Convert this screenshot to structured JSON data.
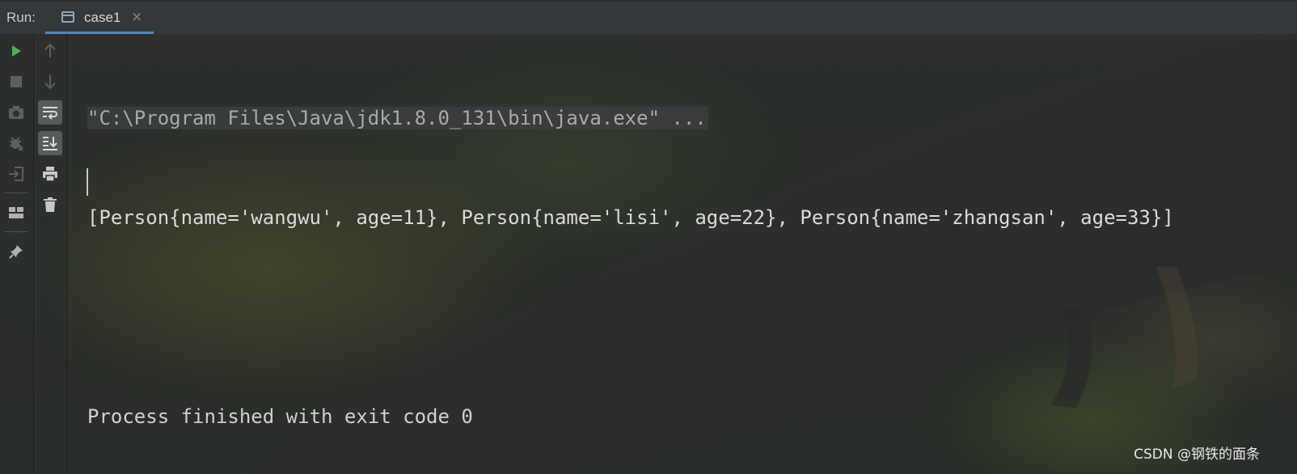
{
  "run_panel": {
    "label": "Run:",
    "tab": {
      "title": "case1",
      "icon": "console-window-icon",
      "close_glyph": "×"
    }
  },
  "toolbar_left": [
    {
      "name": "rerun-icon",
      "glyph": "▶",
      "color": "#4caf50"
    },
    {
      "name": "stop-icon",
      "glyph": "■",
      "color": "#6e6e6e"
    },
    {
      "name": "camera-icon",
      "glyph": "camera",
      "color": "#6e6e6e"
    },
    {
      "name": "debug-icon",
      "glyph": "bug",
      "color": "#6e6e6e"
    },
    {
      "name": "exit-icon",
      "glyph": "exit",
      "color": "#6e6e6e"
    },
    {
      "name": "layout-icon",
      "glyph": "layout",
      "color": "#b0b0b0"
    },
    {
      "name": "pin-icon",
      "glyph": "pin",
      "color": "#b0b0b0"
    }
  ],
  "toolbar_right": [
    {
      "name": "up-arrow-icon",
      "glyph": "↑",
      "color": "#6e6e6e"
    },
    {
      "name": "down-arrow-icon",
      "glyph": "↓",
      "color": "#6e6e6e"
    },
    {
      "name": "soft-wrap-icon",
      "glyph": "wrap",
      "color": "#d0d0d0",
      "active": true
    },
    {
      "name": "scroll-to-end-icon",
      "glyph": "scroll-end",
      "color": "#d0d0d0",
      "active": true
    },
    {
      "name": "print-icon",
      "glyph": "print",
      "color": "#c8c8c8"
    },
    {
      "name": "trash-icon",
      "glyph": "trash",
      "color": "#c8c8c8"
    }
  ],
  "console": {
    "command": "\"C:\\Program Files\\Java\\jdk1.8.0_131\\bin\\java.exe\" ...",
    "output": "[Person{name='wangwu', age=11}, Person{name='lisi', age=22}, Person{name='zhangsan', age=33}]",
    "blank": "",
    "exit_message": "Process finished with exit code 0"
  },
  "watermark": "CSDN @钢铁的面条",
  "colors": {
    "accent": "#4a88c7",
    "run_green": "#4caf50",
    "console_text": "#d0d0d0"
  }
}
